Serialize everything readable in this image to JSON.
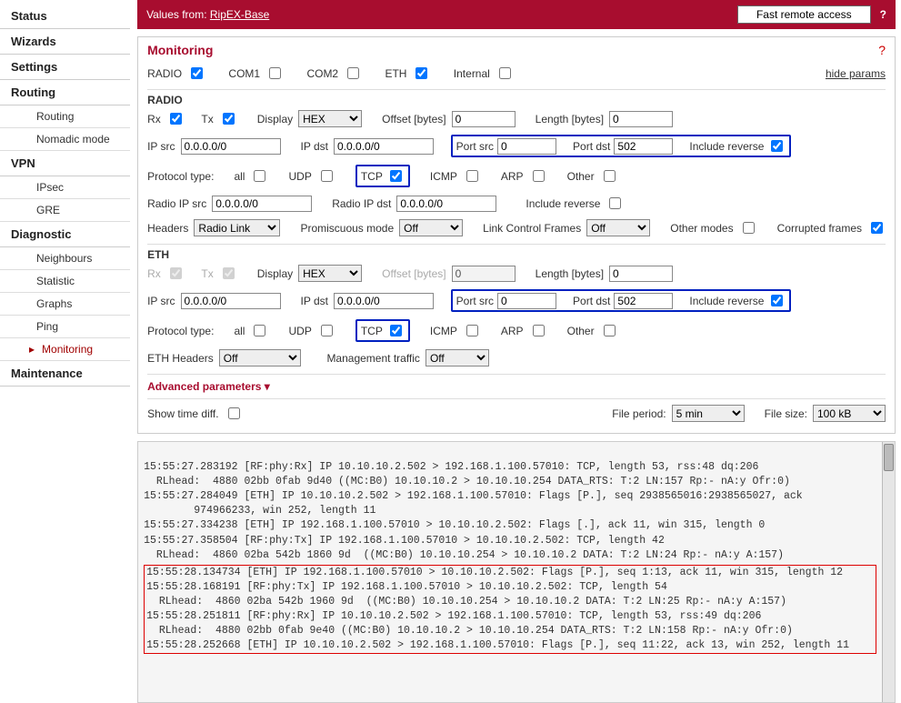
{
  "sidebar": {
    "items": [
      {
        "label": "Status",
        "type": "top"
      },
      {
        "label": "Wizards",
        "type": "top"
      },
      {
        "label": "Settings",
        "type": "top"
      },
      {
        "label": "Routing",
        "type": "top"
      },
      {
        "label": "Routing",
        "type": "sub"
      },
      {
        "label": "Nomadic mode",
        "type": "sub"
      },
      {
        "label": "VPN",
        "type": "top"
      },
      {
        "label": "IPsec",
        "type": "sub"
      },
      {
        "label": "GRE",
        "type": "sub"
      },
      {
        "label": "Diagnostic",
        "type": "top"
      },
      {
        "label": "Neighbours",
        "type": "sub"
      },
      {
        "label": "Statistic",
        "type": "sub"
      },
      {
        "label": "Graphs",
        "type": "sub"
      },
      {
        "label": "Ping",
        "type": "sub"
      },
      {
        "label": "Monitoring",
        "type": "sub",
        "active": true
      },
      {
        "label": "Maintenance",
        "type": "top"
      }
    ]
  },
  "topbar": {
    "values_from_label": "Values from:",
    "values_from_link": "RipEX-Base",
    "fast_remote": "Fast remote access",
    "help": "?"
  },
  "panel": {
    "title": "Monitoring",
    "help": "?",
    "hide_params": "hide params",
    "interfaces": {
      "radio": "RADIO",
      "com1": "COM1",
      "com2": "COM2",
      "eth": "ETH",
      "internal": "Internal"
    },
    "interfaces_checked": {
      "radio": true,
      "com1": false,
      "com2": false,
      "eth": true,
      "internal": false
    },
    "radio_header": "RADIO",
    "eth_header": "ETH",
    "labels": {
      "rx": "Rx",
      "tx": "Tx",
      "display": "Display",
      "offset": "Offset [bytes]",
      "length": "Length [bytes]",
      "ip_src": "IP src",
      "ip_dst": "IP dst",
      "port_src": "Port src",
      "port_dst": "Port dst",
      "include_reverse": "Include reverse",
      "protocol_type": "Protocol type:",
      "all": "all",
      "udp": "UDP",
      "tcp": "TCP",
      "icmp": "ICMP",
      "arp": "ARP",
      "other": "Other",
      "radio_ip_src": "Radio IP src",
      "radio_ip_dst": "Radio IP dst",
      "headers": "Headers",
      "promiscuous": "Promiscuous mode",
      "link_control": "Link Control Frames",
      "other_modes": "Other modes",
      "corrupted": "Corrupted frames",
      "eth_headers": "ETH Headers",
      "mgmt_traffic": "Management traffic",
      "adv_params": "Advanced parameters",
      "show_time_diff": "Show time diff.",
      "file_period": "File period:",
      "file_size": "File size:"
    },
    "radio": {
      "rx": true,
      "tx": true,
      "display": "HEX",
      "offset": "0",
      "length": "0",
      "ip_src": "0.0.0.0/0",
      "ip_dst": "0.0.0.0/0",
      "port_src": "0",
      "port_dst": "502",
      "include_reverse": true,
      "proto": {
        "all": false,
        "udp": false,
        "tcp": true,
        "icmp": false,
        "arp": false,
        "other": false
      },
      "radio_ip_src": "0.0.0.0/0",
      "radio_ip_dst": "0.0.0.0/0",
      "radio_include_reverse": false,
      "headers": "Radio Link",
      "promiscuous": "Off",
      "link_control": "Off",
      "other_modes": false,
      "corrupted": true
    },
    "eth": {
      "rx": true,
      "tx": true,
      "display": "HEX",
      "offset": "0",
      "length": "0",
      "ip_src": "0.0.0.0/0",
      "ip_dst": "0.0.0.0/0",
      "port_src": "0",
      "port_dst": "502",
      "include_reverse": true,
      "proto": {
        "all": false,
        "udp": false,
        "tcp": true,
        "icmp": false,
        "arp": false,
        "other": false
      },
      "eth_headers": "Off",
      "mgmt_traffic": "Off"
    },
    "footer": {
      "show_time_diff": false,
      "file_period": "5 min",
      "file_size": "100 kB"
    }
  },
  "log_lines": [
    "15:55:27.283192 [RF:phy:Rx] IP 10.10.10.2.502 > 192.168.1.100.57010: TCP, length 53, rss:48 dq:206",
    "  RLhead:  4880 02bb 0fab 9d40 ((MC:B0) 10.10.10.2 > 10.10.10.254 DATA_RTS: T:2 LN:157 Rp:- nA:y Ofr:0)",
    "15:55:27.284049 [ETH] IP 10.10.10.2.502 > 192.168.1.100.57010: Flags [P.], seq 2938565016:2938565027, ack ",
    "        974966233, win 252, length 11",
    "15:55:27.334238 [ETH] IP 192.168.1.100.57010 > 10.10.10.2.502: Flags [.], ack 11, win 315, length 0",
    "15:55:27.358504 [RF:phy:Tx] IP 192.168.1.100.57010 > 10.10.10.2.502: TCP, length 42",
    "  RLhead:  4860 02ba 542b 1860 9d  ((MC:B0) 10.10.10.254 > 10.10.10.2 DATA: T:2 LN:24 Rp:- nA:y A:157)"
  ],
  "log_lines_hl": [
    "15:55:28.134734 [ETH] IP 192.168.1.100.57010 > 10.10.10.2.502: Flags [P.], seq 1:13, ack 11, win 315, length 12",
    "15:55:28.168191 [RF:phy:Tx] IP 192.168.1.100.57010 > 10.10.10.2.502: TCP, length 54",
    "  RLhead:  4860 02ba 542b 1960 9d  ((MC:B0) 10.10.10.254 > 10.10.10.2 DATA: T:2 LN:25 Rp:- nA:y A:157)",
    "15:55:28.251811 [RF:phy:Rx] IP 10.10.10.2.502 > 192.168.1.100.57010: TCP, length 53, rss:49 dq:206",
    "  RLhead:  4880 02bb 0fab 9e40 ((MC:B0) 10.10.10.2 > 10.10.10.254 DATA_RTS: T:2 LN:158 Rp:- nA:y Ofr:0)",
    "15:55:28.252668 [ETH] IP 10.10.10.2.502 > 192.168.1.100.57010: Flags [P.], seq 11:22, ack 13, win 252, length 11"
  ]
}
